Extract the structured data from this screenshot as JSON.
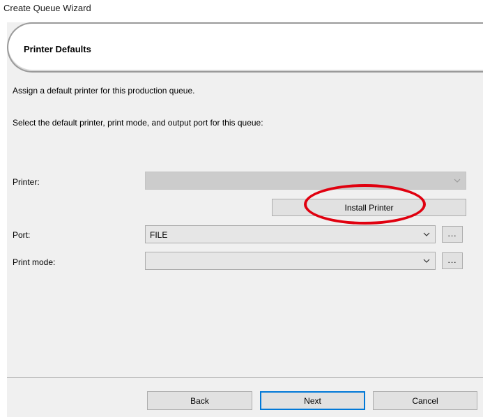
{
  "window": {
    "title": "Create Queue Wizard"
  },
  "header": {
    "title": "Printer Defaults"
  },
  "descriptions": {
    "line1": "Assign a default printer for this production queue.",
    "line2": "Select the default printer, print mode, and output port for this queue:"
  },
  "form": {
    "printer_label": "Printer:",
    "printer_value": "",
    "install_printer_label": "Install Printer",
    "port_label": "Port:",
    "port_value": "FILE",
    "port_more_label": "...",
    "print_mode_label": "Print mode:",
    "print_mode_value": "",
    "print_mode_more_label": "..."
  },
  "footer": {
    "back_label": "Back",
    "next_label": "Next",
    "cancel_label": "Cancel"
  },
  "colors": {
    "annotation": "#e0000f",
    "dialog_bg": "#f0f0f0",
    "focus_border": "#0078d7"
  },
  "icons": {
    "dropdown": "chevron-down-icon",
    "annotation": "red-ellipse-highlight"
  }
}
